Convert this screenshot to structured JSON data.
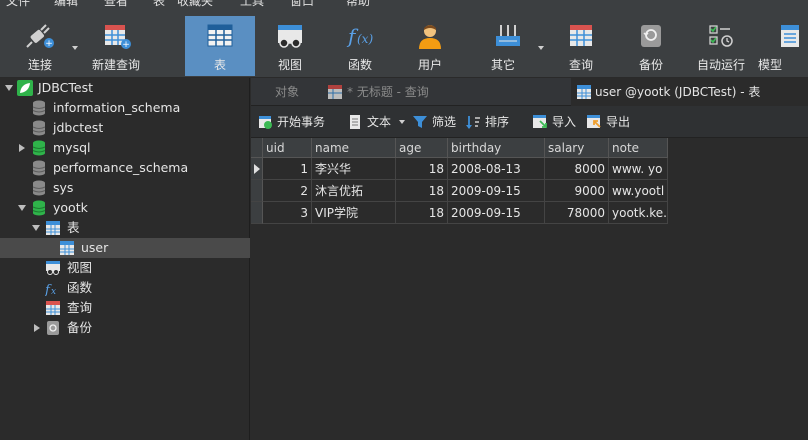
{
  "menu": [
    "文件",
    "编辑",
    "查看",
    "表",
    "收藏夹",
    "工具",
    "窗口",
    "帮助"
  ],
  "toolbar": {
    "items": [
      {
        "label": "连接",
        "icon": "connect-plug-icon"
      },
      {
        "label": "新建查询",
        "icon": "new-query-icon"
      },
      {
        "label": "表",
        "icon": "table-icon",
        "active": true
      },
      {
        "label": "视图",
        "icon": "view-icon"
      },
      {
        "label": "函数",
        "icon": "function-fx-icon"
      },
      {
        "label": "用户",
        "icon": "user-icon"
      },
      {
        "label": "其它",
        "icon": "other-tools-icon"
      },
      {
        "label": "查询",
        "icon": "query-icon"
      },
      {
        "label": "备份",
        "icon": "backup-icon"
      },
      {
        "label": "自动运行",
        "icon": "schedule-icon"
      },
      {
        "label": "模型",
        "icon": "model-icon"
      }
    ]
  },
  "sidebar": {
    "connection": "JDBCTest",
    "databases": [
      "information_schema",
      "jdbctest",
      "mysql",
      "performance_schema",
      "sys",
      "yootk"
    ],
    "yootk_children": {
      "tables_label": "表",
      "table_user": "user",
      "views_label": "视图",
      "functions_label": "函数",
      "queries_label": "查询",
      "backups_label": "备份"
    }
  },
  "tabs": [
    {
      "label": "对象",
      "active": false
    },
    {
      "label": "* 无标题 - 查询",
      "active": false
    },
    {
      "label": "user @yootk (JDBCTest) - 表",
      "active": true
    }
  ],
  "gridbar": {
    "begin_transaction": "开始事务",
    "text": "文本",
    "filter": "筛选",
    "sort": "排序",
    "import": "导入",
    "export": "导出"
  },
  "grid": {
    "columns": [
      "uid",
      "name",
      "age",
      "birthday",
      "salary",
      "note"
    ],
    "rows": [
      [
        "1",
        "李兴华",
        "18",
        "2008-08-13",
        "8000",
        "www. yo"
      ],
      [
        "2",
        "沐言优拓",
        "18",
        "2009-09-15",
        "9000",
        "ww.yootl"
      ],
      [
        "3",
        "VIP学院",
        "18",
        "2009-09-15",
        "78000",
        "yootk.ke."
      ]
    ]
  },
  "colors": {
    "accent": "#5a8fc2",
    "db_green": "#2fb34a",
    "db_gray": "#8a8a8a"
  }
}
